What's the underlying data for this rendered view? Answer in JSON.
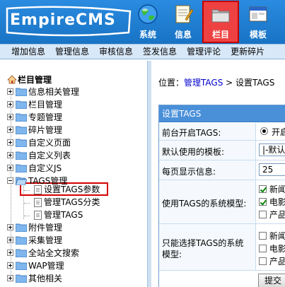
{
  "header": {
    "logo_text": "EmpireCMS",
    "nav": [
      {
        "label": "系统",
        "icon": "globe-icon"
      },
      {
        "label": "信息",
        "icon": "notepad-icon"
      },
      {
        "label": "栏目",
        "icon": "folder-icon"
      },
      {
        "label": "模板",
        "icon": "window-icon"
      }
    ]
  },
  "submenu": [
    "增加信息",
    "管理信息",
    "审核信息",
    "签发信息",
    "管理评论",
    "更新碎片"
  ],
  "tree": {
    "title": "栏目管理",
    "nodes": [
      "信息相关管理",
      "栏目管理",
      "专题管理",
      "碎片管理",
      "自定义页面",
      "自定义列表",
      "自定义JS",
      "TAGS管理",
      "附件管理",
      "采集管理",
      "全站全文搜索",
      "WAP管理",
      "其他相关"
    ],
    "tags_children": [
      "设置TAGS参数",
      "管理TAGS分类",
      "管理TAGS"
    ]
  },
  "main": {
    "breadcrumb_prefix": "位置：",
    "breadcrumb_link": "管理TAGS",
    "breadcrumb_sep": " > ",
    "breadcrumb_current": "设置TAGS",
    "panel_title": "设置TAGS",
    "rows": {
      "frontend_label": "前台开启TAGS:",
      "frontend_value": "开启",
      "template_label": "默认使用的模板:",
      "template_value": "|-默认新闻",
      "per_page_label": "每页显示信息:",
      "per_page_value": "25",
      "system_model_label": "使用TAGS的系统模型:",
      "system_models": [
        "新闻",
        "电影",
        "产品"
      ],
      "only_select_label_1": "只能选择TAGS的系统",
      "only_select_label_2": "模型:",
      "only_models": [
        "新闻",
        "电影",
        "产品"
      ],
      "submit_label": "提交"
    }
  },
  "colors": {
    "header_blue": "#1f7fd0",
    "highlight_red": "#d40000",
    "link_blue": "#0000cc"
  }
}
